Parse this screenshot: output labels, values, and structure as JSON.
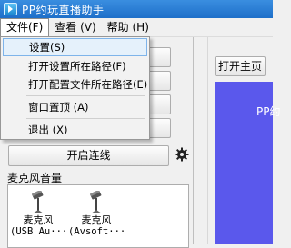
{
  "window": {
    "title": "PP约玩直播助手",
    "icon": "app-play-icon"
  },
  "menubar": {
    "items": [
      {
        "label": "文件(F)",
        "active": true
      },
      {
        "label": "查看 (V)",
        "active": false
      },
      {
        "label": "帮助 (H)",
        "active": false
      }
    ]
  },
  "file_menu": {
    "items": [
      {
        "label": "设置(S)",
        "highlighted": true
      },
      {
        "label": "打开设置所在路径(F)"
      },
      {
        "label": "打开配置文件所在路径(E)"
      },
      {
        "label": "窗口置顶 (A)"
      },
      {
        "label": "退出 (X)"
      }
    ]
  },
  "left_panel": {
    "connect_button": "开启连线",
    "mic_section_label": "麦克风音量",
    "mics": [
      {
        "name": "麦克风",
        "device": "(USB Au···"
      },
      {
        "name": "麦克风",
        "device": "(Avsoft···"
      }
    ]
  },
  "right_panel": {
    "open_home_button": "打开主页",
    "banner_text": "PP约",
    "banner_color": "#5a58ec"
  }
}
